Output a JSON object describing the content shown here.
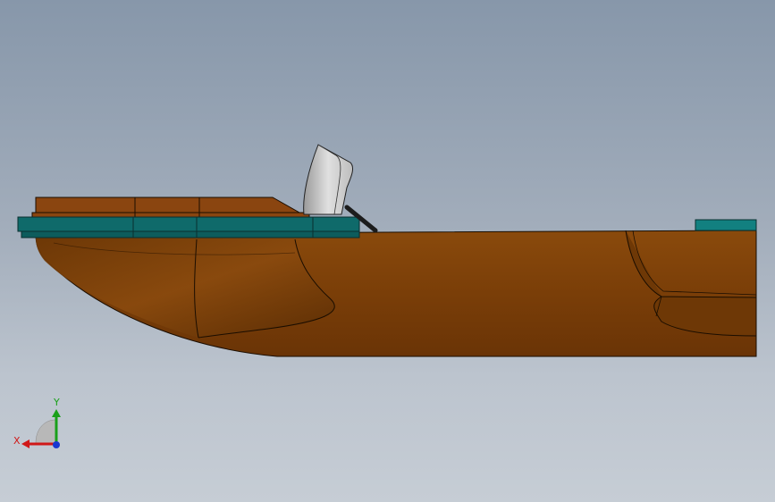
{
  "viewport": {
    "background_top": "#8797aa",
    "background_bottom": "#c6cdd5"
  },
  "model": {
    "hull_color": "#7a3e08",
    "hull_shadow": "#5e2f05",
    "deck_color": "#0f6a6a",
    "deck_lid_color": "#8a4510",
    "windshield_color": "#cfcfcf"
  },
  "triad": {
    "x_label": "X",
    "y_label": "Y",
    "x_color": "#d01818",
    "y_color": "#1aa01a",
    "z_color": "#1838d0"
  }
}
